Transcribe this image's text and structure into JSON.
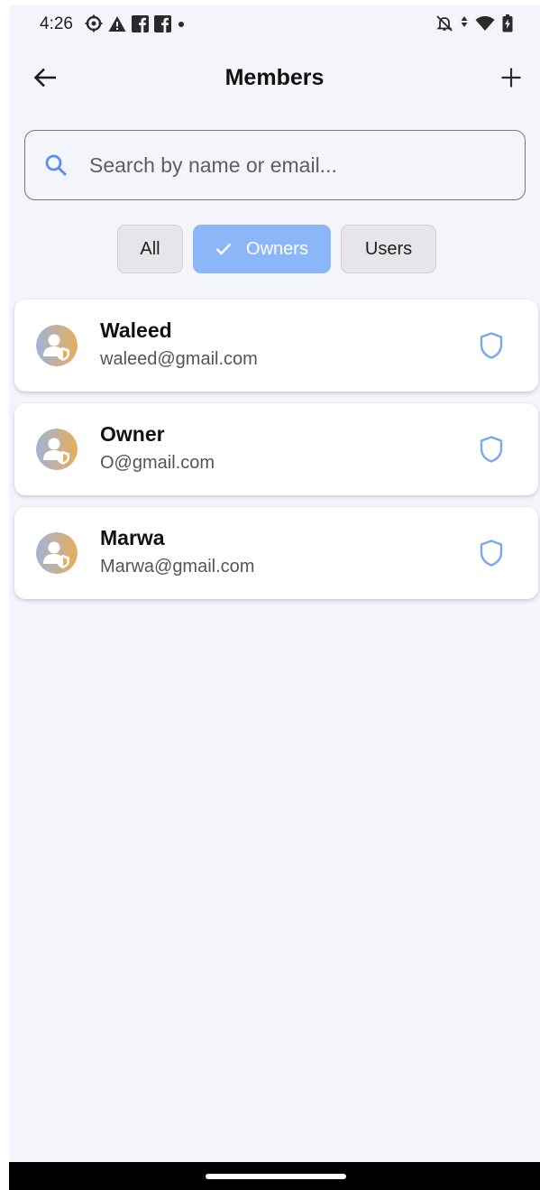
{
  "status_bar": {
    "time": "4:26",
    "left_icons": [
      "settings-gear-icon",
      "warning-icon",
      "facebook-icon",
      "facebook-icon",
      "dot-icon"
    ],
    "right_icons": [
      "notifications-off-icon",
      "data-arrows-icon",
      "wifi-icon",
      "battery-icon"
    ]
  },
  "app_bar": {
    "title": "Members",
    "back_icon": "arrow-left-icon",
    "add_icon": "plus-icon"
  },
  "search": {
    "placeholder": "Search by name or email...",
    "value": ""
  },
  "filters": {
    "all_label": "All",
    "owners_label": "Owners",
    "users_label": "Users",
    "selected": "Owners"
  },
  "members": [
    {
      "name": "Waleed",
      "email": "waleed@gmail.com",
      "role_icon": "shield-icon"
    },
    {
      "name": "Owner",
      "email": "O@gmail.com",
      "role_icon": "shield-icon"
    },
    {
      "name": "Marwa",
      "email": "Marwa@gmail.com",
      "role_icon": "shield-icon"
    }
  ],
  "colors": {
    "background": "#f4f4fb",
    "accent": "#8bb6f8",
    "shield": "#7aa8f0",
    "search_icon": "#5a8ef0",
    "avatar_gradient_start": "#9fb4d9",
    "avatar_gradient_end": "#e8ad5a"
  }
}
